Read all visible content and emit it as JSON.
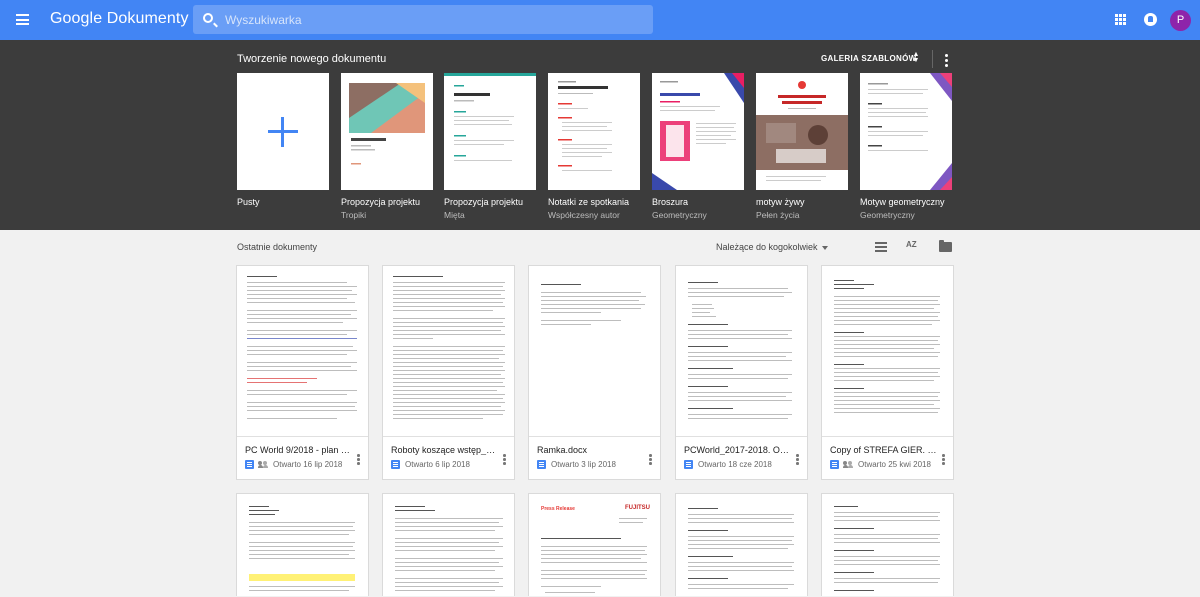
{
  "app": {
    "logo": "Google Dokumenty"
  },
  "search": {
    "placeholder": "Wyszukiwarka"
  },
  "user": {
    "initial": "P",
    "avatar_color": "#8e24aa"
  },
  "colors": {
    "brand": "#4285f4",
    "template_bg": "#3c3c3c",
    "page_bg": "#f1f1f1"
  },
  "templates": {
    "heading": "Tworzenie nowego dokumentu",
    "gallery_label": "GALERIA SZABLONÓW",
    "items": [
      {
        "name": "Pusty",
        "sub": ""
      },
      {
        "name": "Propozycja projektu",
        "sub": "Tropiki"
      },
      {
        "name": "Propozycja projektu",
        "sub": "Mięta"
      },
      {
        "name": "Notatki ze spotkania",
        "sub": "Współczesny autor"
      },
      {
        "name": "Broszura",
        "sub": "Geometryczny"
      },
      {
        "name": "motyw żywy",
        "sub": "Pełen życia"
      },
      {
        "name": "Motyw geometryczny",
        "sub": "Geometryczny"
      }
    ]
  },
  "recent": {
    "heading": "Ostatnie dokumenty",
    "owner_filter": "Należące do kogokolwiek",
    "sort_icon_label": "AZ",
    "docs": [
      {
        "title": "PC World 9/2018 - plan w...",
        "opened": "Otwarto 16 lip 2018",
        "shared": true
      },
      {
        "title": "Roboty koszące wstęp_H...",
        "opened": "Otwarto 6 lip 2018",
        "shared": false
      },
      {
        "title": "Ramka.docx",
        "opened": "Otwarto 3 lip 2018",
        "shared": false
      },
      {
        "title": "PCWorld_2017-2018. Od ...",
        "opened": "Otwarto 18 cze 2018",
        "shared": false
      },
      {
        "title": "Copy of STREFA GIER. Re...",
        "opened": "Otwarto 25 kwi 2018",
        "shared": true
      }
    ],
    "row2_preview_labels": {
      "press_release": "Press Release",
      "fujitsu": "FUJITSU"
    }
  }
}
